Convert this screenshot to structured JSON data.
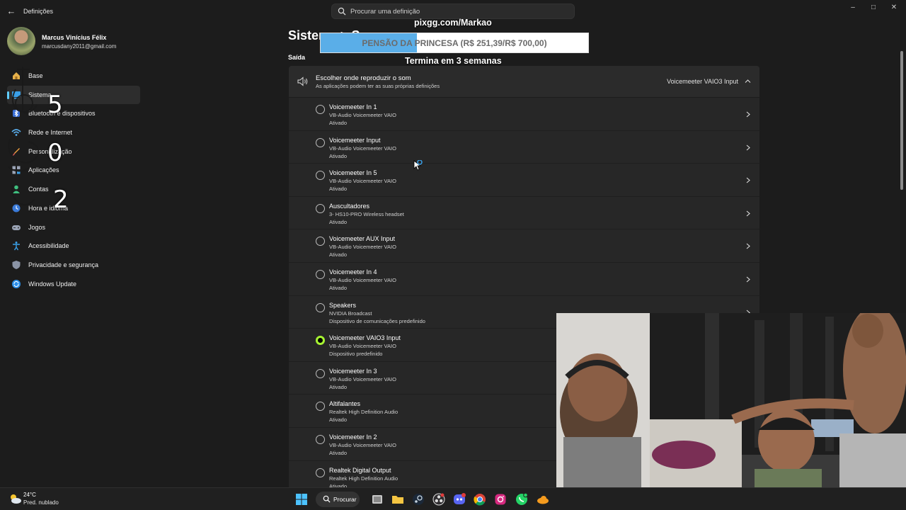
{
  "window": {
    "title": "Definições",
    "search_placeholder": "Procurar uma definição"
  },
  "profile": {
    "name": "Marcus Vinícius Félix",
    "email": "marcusdany2011@gmail.com"
  },
  "sidebar": {
    "items": [
      {
        "label": "Base",
        "icon": "home-icon"
      },
      {
        "label": "Sistema",
        "icon": "system-icon",
        "active": true
      },
      {
        "label": "Bluetooth e dispositivos",
        "icon": "bluetooth-icon"
      },
      {
        "label": "Rede e Internet",
        "icon": "network-icon"
      },
      {
        "label": "Personalização",
        "icon": "brush-icon"
      },
      {
        "label": "Aplicações",
        "icon": "apps-icon"
      },
      {
        "label": "Contas",
        "icon": "accounts-icon"
      },
      {
        "label": "Hora e idioma",
        "icon": "time-language-icon"
      },
      {
        "label": "Jogos",
        "icon": "gaming-icon"
      },
      {
        "label": "Acessibilidade",
        "icon": "accessibility-icon"
      },
      {
        "label": "Privacidade e segurança",
        "icon": "shield-icon"
      },
      {
        "label": "Windows Update",
        "icon": "update-icon"
      }
    ]
  },
  "overlay_digits": [
    "5",
    "0",
    "2"
  ],
  "page": {
    "title": "Sistema > Som",
    "section": "Saída"
  },
  "output": {
    "title": "Escolher onde reproduzir o som",
    "subtitle": "As aplicações podem ter as suas próprias definições",
    "selected": "Voicemeeter VAIO3 Input"
  },
  "devices": [
    {
      "name": "Voicemeeter In 1",
      "driver": "VB-Audio Voicemeeter VAIO",
      "status": "Ativado",
      "checked": false
    },
    {
      "name": "Voicemeeter Input",
      "driver": "VB-Audio Voicemeeter VAIO",
      "status": "Ativado",
      "checked": false
    },
    {
      "name": "Voicemeeter In 5",
      "driver": "VB-Audio Voicemeeter VAIO",
      "status": "Ativado",
      "checked": false
    },
    {
      "name": "Auscultadores",
      "driver": "3- HS10-PRO Wireless headset",
      "status": "Ativado",
      "checked": false
    },
    {
      "name": "Voicemeeter AUX Input",
      "driver": "VB-Audio Voicemeeter VAIO",
      "status": "Ativado",
      "checked": false
    },
    {
      "name": "Voicemeeter In 4",
      "driver": "VB-Audio Voicemeeter VAIO",
      "status": "Ativado",
      "checked": false
    },
    {
      "name": "Speakers",
      "driver": "NVIDIA Broadcast",
      "status": "Dispositivo de comunicações predefinido",
      "checked": false
    },
    {
      "name": "Voicemeeter VAIO3 Input",
      "driver": "VB-Audio Voicemeeter VAIO",
      "status": "Dispositivo predefinido",
      "checked": true
    },
    {
      "name": "Voicemeeter In 3",
      "driver": "VB-Audio Voicemeeter VAIO",
      "status": "Ativado",
      "checked": false
    },
    {
      "name": "Altifalantes",
      "driver": "Realtek High Definition Audio",
      "status": "Ativado",
      "checked": false
    },
    {
      "name": "Voicemeeter In 2",
      "driver": "VB-Audio Voicemeeter VAIO",
      "status": "Ativado",
      "checked": false
    },
    {
      "name": "Realtek Digital Output",
      "driver": "Realtek High Definition Audio",
      "status": "Ativado",
      "checked": false
    }
  ],
  "stream_overlay": {
    "url": "pixgg.com/Markao",
    "goal_text": "PENSÃO DA PRINCESA (R$ 251,39/R$ 700,00)",
    "goal_progress": 0.359,
    "ends_text": "Termina em 3 semanas"
  },
  "taskbar": {
    "weather_temp": "24°C",
    "weather_desc": "Pred. nublado",
    "search_label": "Procurar",
    "icons": [
      "start-icon",
      "task-view-icon",
      "file-explorer-icon",
      "steam-icon",
      "obs-icon",
      "discord-icon",
      "chrome-icon",
      "instagram-icon",
      "whatsapp-icon",
      "cloud-icon"
    ]
  },
  "colors": {
    "accent": "#60cdff",
    "radio_selected": "#a7f432",
    "goal_fill": "#5aaee8"
  }
}
